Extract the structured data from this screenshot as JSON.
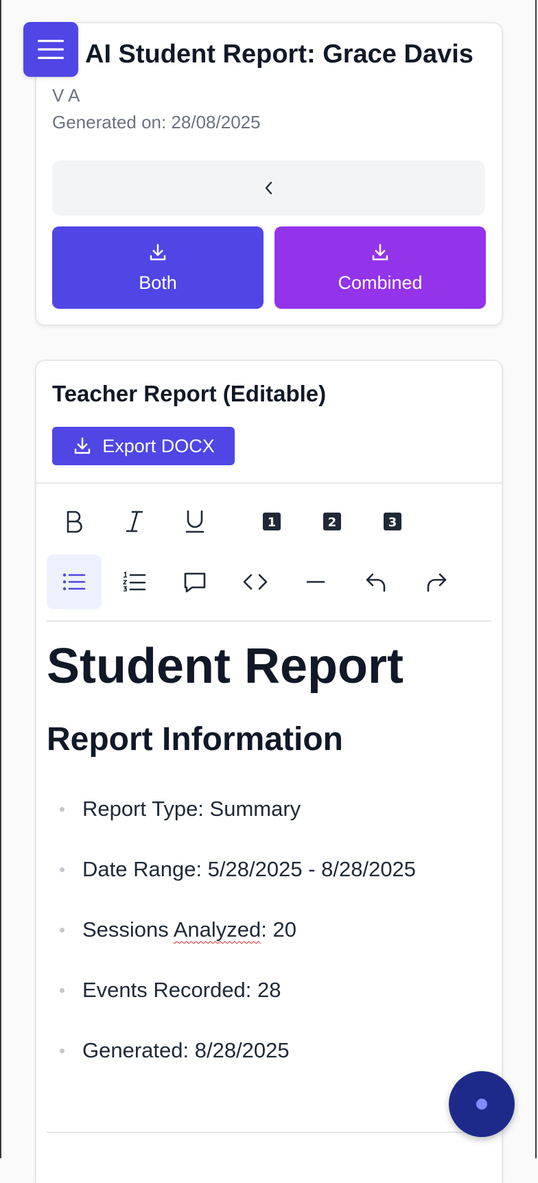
{
  "header": {
    "title": "AI Student Report: Grace Davis",
    "class_name": "V A",
    "generated": "Generated on: 28/08/2025",
    "buttons": {
      "both": "Both",
      "combined": "Combined"
    }
  },
  "editor": {
    "title": "Teacher Report (Editable)",
    "export_label": "Export DOCX",
    "toolbar": {
      "h1": "1",
      "h2": "2",
      "h3": "3"
    }
  },
  "document": {
    "h1": "Student Report",
    "h2": "Report Information",
    "items": [
      "Report Type: Summary",
      "Date Range: 5/28/2025 - 8/28/2025",
      "Sessions ",
      "Events Recorded: 28",
      "Generated: 8/28/2025"
    ],
    "sessions_word": "Analyzed",
    "sessions_rest": ": 20"
  },
  "colors": {
    "primary": "#4f46e5",
    "purple": "#9333ea",
    "fab": "#1e2a8a"
  }
}
